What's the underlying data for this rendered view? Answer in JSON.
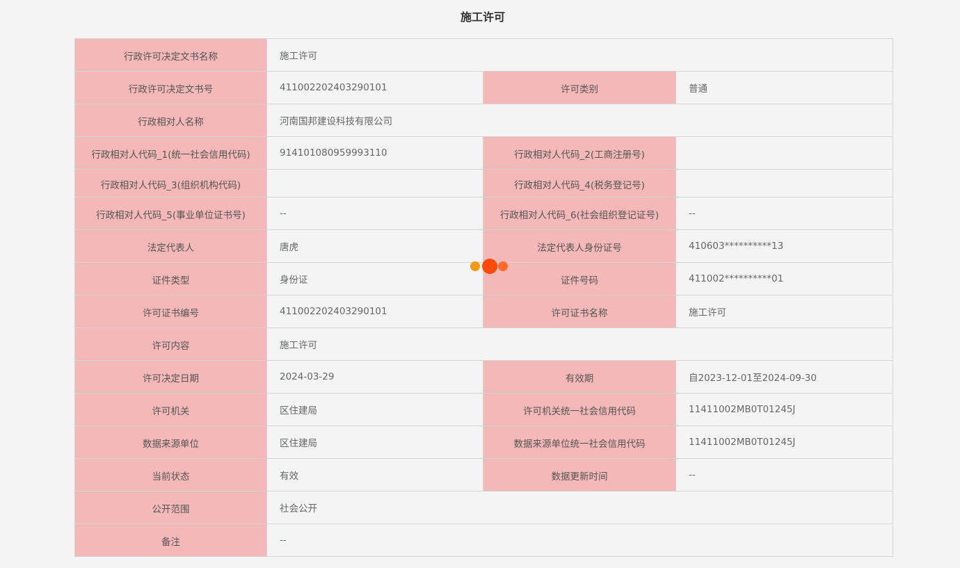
{
  "title": "施工许可",
  "rows": [
    {
      "l1": "行政许可决定文书名称",
      "v1": "施工许可"
    },
    {
      "l1": "行政许可决定文书号",
      "v1": "411002202403290101",
      "l2": "许可类别",
      "v2": "普通"
    },
    {
      "l1": "行政相对人名称",
      "v1": "河南国邦建设科技有限公司"
    },
    {
      "l1": "行政相对人代码_1(统一社会信用代码)",
      "v1": "914101080959993110",
      "l2": "行政相对人代码_2(工商注册号)",
      "v2": ""
    },
    {
      "l1": "行政相对人代码_3(组织机构代码)",
      "v1": "",
      "l2": "行政相对人代码_4(税务登记号)",
      "v2": ""
    },
    {
      "l1": "行政相对人代码_5(事业单位证书号)",
      "v1": "--",
      "l2": "行政相对人代码_6(社会组织登记证号)",
      "v2": "--"
    },
    {
      "l1": "法定代表人",
      "v1": "唐虎",
      "l2": "法定代表人身份证号",
      "v2": "410603**********13"
    },
    {
      "l1": "证件类型",
      "v1": "身份证",
      "l2": "证件号码",
      "v2": "411002**********01"
    },
    {
      "l1": "许可证书编号",
      "v1": "411002202403290101",
      "l2": "许可证书名称",
      "v2": "施工许可"
    },
    {
      "l1": "许可内容",
      "v1": "施工许可"
    },
    {
      "l1": "许可决定日期",
      "v1": "2024-03-29",
      "l2": "有效期",
      "v2": "自2023-12-01至2024-09-30"
    },
    {
      "l1": "许可机关",
      "v1": "区住建局",
      "l2": "许可机关统一社会信用代码",
      "v2": "11411002MB0T01245J"
    },
    {
      "l1": "数据来源单位",
      "v1": "区住建局",
      "l2": "数据来源单位统一社会信用代码",
      "v2": "11411002MB0T01245J"
    },
    {
      "l1": "当前状态",
      "v1": "有效",
      "l2": "数据更新时间",
      "v2": "--"
    },
    {
      "l1": "公开范围",
      "v1": "社会公开"
    },
    {
      "l1": "备注",
      "v1": "--"
    }
  ],
  "colors": {
    "label_bg": "#f4b8b8",
    "value_bg": "#f4f4f4",
    "border": "#d4d4d4",
    "loader_dot_1": "#f59a11",
    "loader_dot_2": "#ff4a0a",
    "loader_dot_3": "#ff6a2a"
  }
}
